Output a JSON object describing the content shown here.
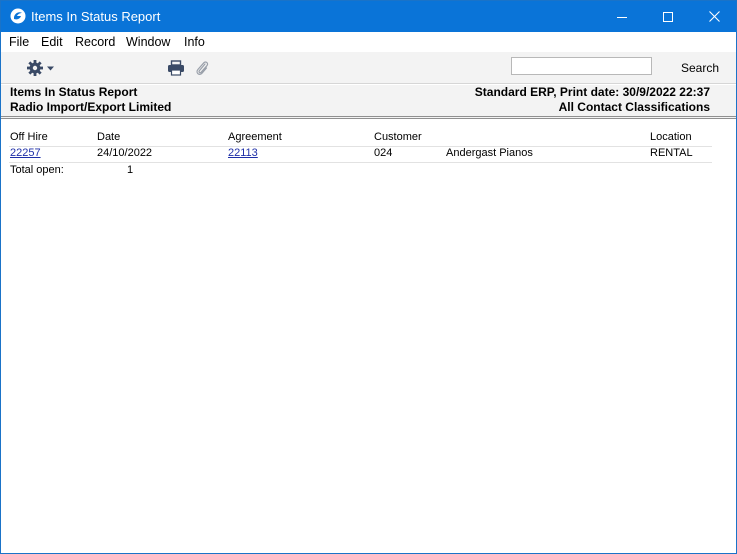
{
  "window": {
    "title": "Items In Status Report",
    "accent_color": "#0a74d8",
    "icons": {
      "app": "hansa-app-icon",
      "minimize": "minimize-icon",
      "maximize": "maximize-icon",
      "close": "close-icon"
    }
  },
  "menu": {
    "items": [
      "File",
      "Edit",
      "Record",
      "Window",
      "Info"
    ]
  },
  "toolbar": {
    "icons": {
      "settings": "gear-icon",
      "print": "print-icon",
      "attach": "paperclip-icon"
    },
    "search_value": "",
    "search_label": "Search"
  },
  "report_header": {
    "title": "Items In Status Report",
    "company": "Radio Import/Export Limited",
    "print_info": "Standard ERP, Print date: 30/9/2022 22:37",
    "classification": "All Contact Classifications"
  },
  "report": {
    "columns": [
      "Off Hire",
      "Date",
      "Agreement",
      "Customer",
      "Location"
    ],
    "rows": [
      {
        "off_hire": "22257",
        "date": "24/10/2022",
        "agreement": "22113",
        "customer_code": "024",
        "customer_name": "Andergast Pianos",
        "location": "RENTAL"
      }
    ],
    "total_label": "Total open:",
    "total_value": "1"
  }
}
